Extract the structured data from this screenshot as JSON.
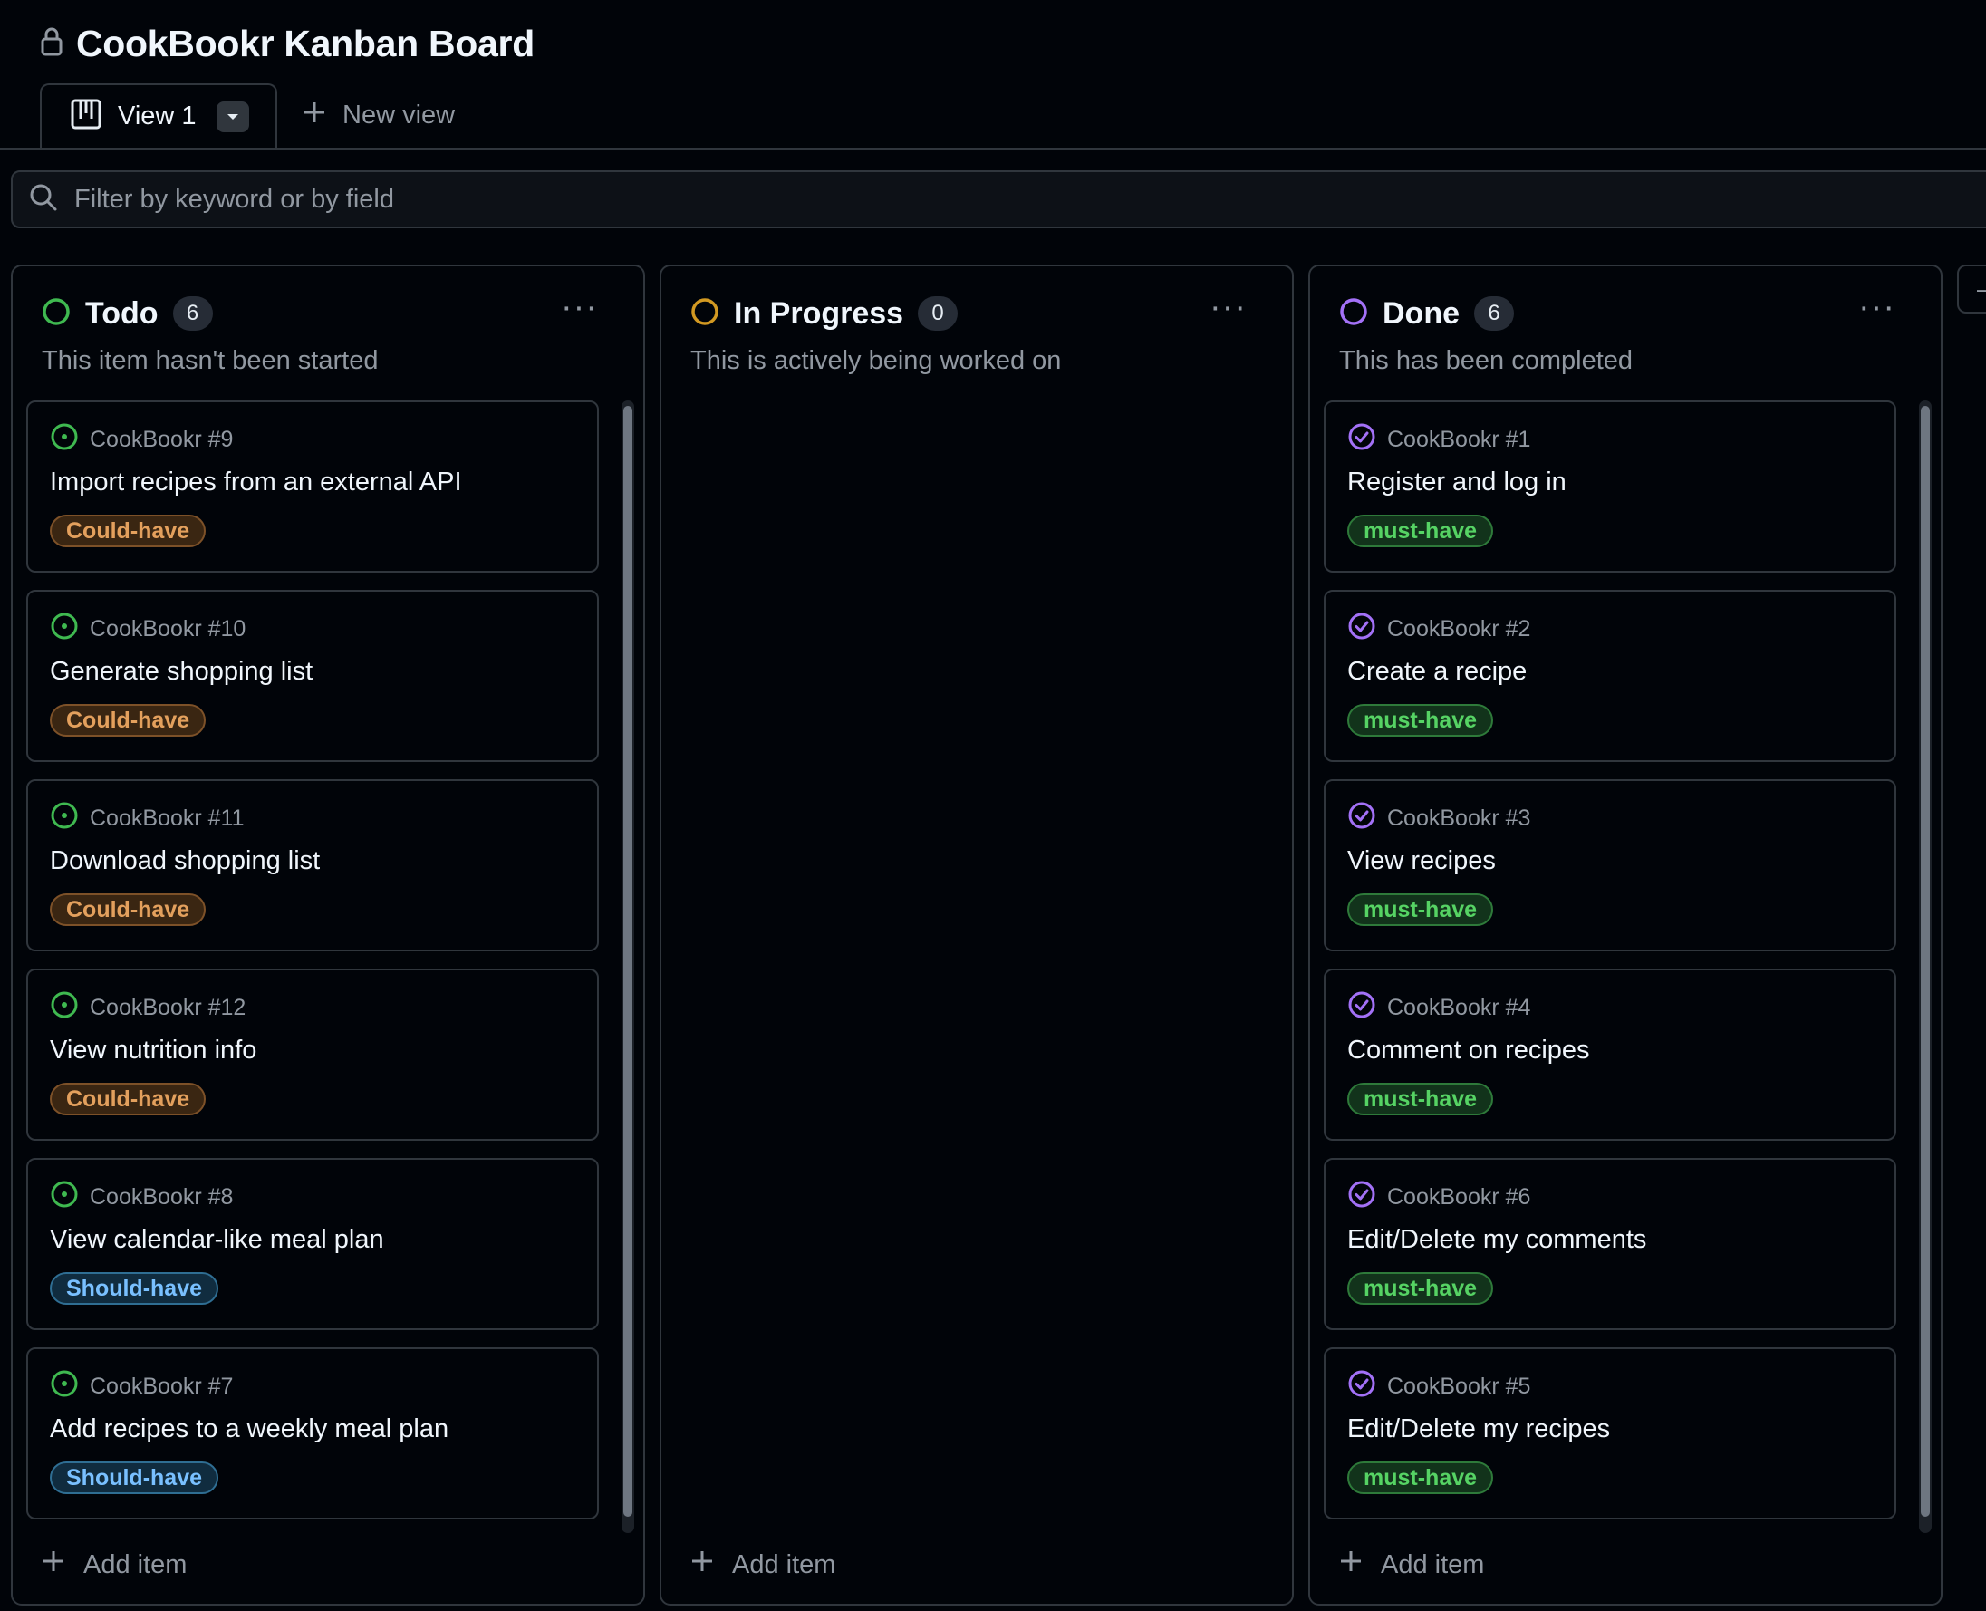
{
  "header": {
    "title": "CookBookr Kanban Board"
  },
  "tabs": {
    "view_label": "View 1",
    "new_view_label": "New view"
  },
  "filter": {
    "placeholder": "Filter by keyword or by field"
  },
  "colors": {
    "todo": "#3fb950",
    "in_progress": "#d29922",
    "done": "#a371f7",
    "could_have": {
      "bg": "#3a2612",
      "border": "#7d5128",
      "text": "#e3a05d"
    },
    "should_have": {
      "bg": "#102c3f",
      "border": "#2f6e93",
      "text": "#79c0ff"
    },
    "must_have": {
      "bg": "#12331b",
      "border": "#2e7a3a",
      "text": "#56d364"
    }
  },
  "columns": [
    {
      "title": "Todo",
      "count": "6",
      "description": "This item hasn't been started",
      "add_item": "Add item",
      "cards": [
        {
          "ref": "CookBookr #9",
          "title": "Import recipes from an external API",
          "label": "Could-have"
        },
        {
          "ref": "CookBookr #10",
          "title": "Generate shopping list",
          "label": "Could-have"
        },
        {
          "ref": "CookBookr #11",
          "title": "Download shopping list",
          "label": "Could-have"
        },
        {
          "ref": "CookBookr #12",
          "title": "View nutrition info",
          "label": "Could-have"
        },
        {
          "ref": "CookBookr #8",
          "title": "View calendar-like meal plan",
          "label": "Should-have"
        },
        {
          "ref": "CookBookr #7",
          "title": "Add recipes to a weekly meal plan",
          "label": "Should-have"
        }
      ]
    },
    {
      "title": "In Progress",
      "count": "0",
      "description": "This is actively being worked on",
      "add_item": "Add item",
      "cards": []
    },
    {
      "title": "Done",
      "count": "6",
      "description": "This has been completed",
      "add_item": "Add item",
      "cards": [
        {
          "ref": "CookBookr #1",
          "title": "Register and log in",
          "label": "must-have"
        },
        {
          "ref": "CookBookr #2",
          "title": "Create a recipe",
          "label": "must-have"
        },
        {
          "ref": "CookBookr #3",
          "title": "View recipes",
          "label": "must-have"
        },
        {
          "ref": "CookBookr #4",
          "title": "Comment on recipes",
          "label": "must-have"
        },
        {
          "ref": "CookBookr #6",
          "title": "Edit/Delete my comments",
          "label": "must-have"
        },
        {
          "ref": "CookBookr #5",
          "title": "Edit/Delete my recipes",
          "label": "must-have"
        }
      ]
    }
  ]
}
